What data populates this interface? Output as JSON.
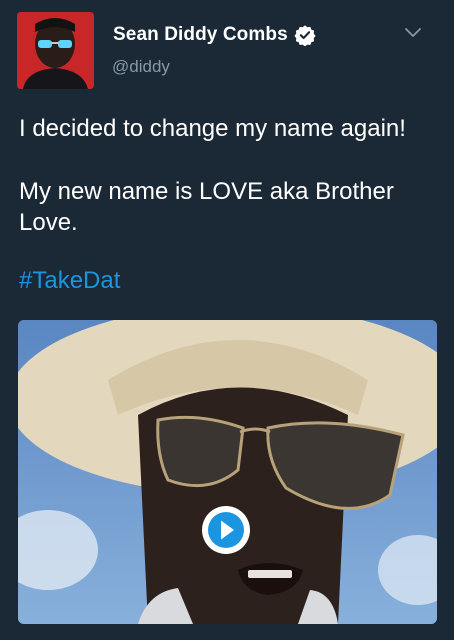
{
  "tweet": {
    "author": {
      "display_name": "Sean Diddy Combs",
      "handle": "@diddy",
      "verified": true,
      "avatar_icon": "profile-photo"
    },
    "text_lines": [
      "I decided to change my name again!",
      "My new name is LOVE aka Brother Love."
    ],
    "hashtag": "#TakeDat",
    "media": {
      "type": "video",
      "play_icon": "play-icon"
    },
    "menu_icon": "chevron-down-icon"
  },
  "colors": {
    "background": "#1b2836",
    "text": "#ffffff",
    "muted": "#8899a6",
    "link": "#1b95e0",
    "avatar_bg": "#c9262a"
  }
}
